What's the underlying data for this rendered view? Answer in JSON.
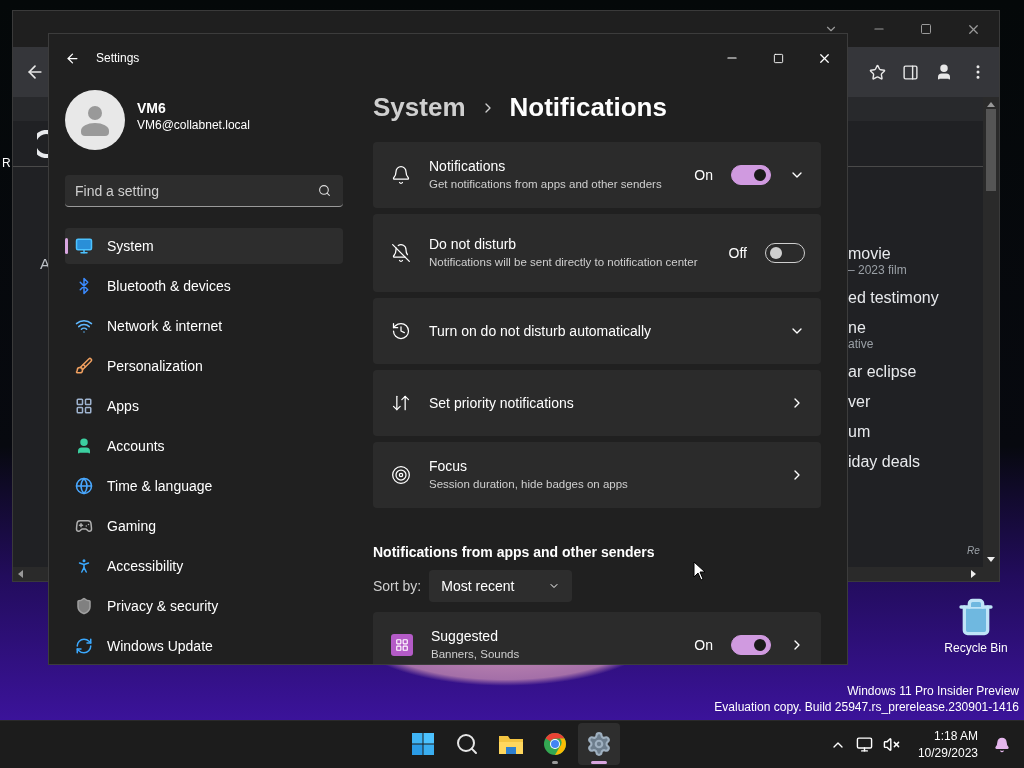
{
  "desktop": {
    "icons": [
      {
        "label": "Recycle Bin"
      }
    ],
    "edge_label": "R",
    "watermark": [
      "Windows 11 Pro Insider Preview",
      "Evaluation copy. Build 25947.rs_prerelease.230901-1416"
    ]
  },
  "browser": {
    "left_fragment": "A",
    "suggestions": [
      {
        "title": "movie",
        "subtitle": "– 2023 film"
      },
      {
        "title": "ed testimony"
      },
      {
        "title": "ne",
        "subtitle": "ative"
      },
      {
        "title": "ar eclipse"
      },
      {
        "title": "ver"
      },
      {
        "title": "um"
      },
      {
        "title": "iday deals"
      }
    ],
    "footer_text": "Re"
  },
  "settings": {
    "title": "Settings",
    "user": {
      "name": "VM6",
      "email": "VM6@collabnet.local"
    },
    "search": {
      "placeholder": "Find a setting"
    },
    "nav": [
      {
        "label": "System",
        "selected": true
      },
      {
        "label": "Bluetooth & devices",
        "selected": false
      },
      {
        "label": "Network & internet",
        "selected": false
      },
      {
        "label": "Personalization",
        "selected": false
      },
      {
        "label": "Apps",
        "selected": false
      },
      {
        "label": "Accounts",
        "selected": false
      },
      {
        "label": "Time & language",
        "selected": false
      },
      {
        "label": "Gaming",
        "selected": false
      },
      {
        "label": "Accessibility",
        "selected": false
      },
      {
        "label": "Privacy & security",
        "selected": false
      },
      {
        "label": "Windows Update",
        "selected": false
      }
    ],
    "breadcrumb": [
      "System",
      "Notifications"
    ],
    "cards": [
      {
        "kind": "toggle_expand",
        "title": "Notifications",
        "subtitle": "Get notifications from apps and other senders",
        "state_label": "On",
        "on": true
      },
      {
        "kind": "toggle",
        "title": "Do not disturb",
        "subtitle": "Notifications will be sent directly to notification center",
        "state_label": "Off",
        "on": false
      },
      {
        "kind": "expand",
        "title": "Turn on do not disturb automatically"
      },
      {
        "kind": "link",
        "title": "Set priority notifications"
      },
      {
        "kind": "link",
        "title": "Focus",
        "subtitle": "Session duration, hide badges on apps"
      }
    ],
    "section_heading": "Notifications from apps and other senders",
    "sort": {
      "label": "Sort by:",
      "value": "Most recent"
    },
    "app_rows": [
      {
        "title": "Suggested",
        "subtitle": "Banners, Sounds",
        "state_label": "On",
        "on": true
      }
    ]
  },
  "taskbar": {
    "apps": [
      {
        "selected": false,
        "running": false
      },
      {
        "selected": false,
        "running": false
      },
      {
        "selected": false,
        "running": false
      },
      {
        "selected": false,
        "running": true
      },
      {
        "selected": true,
        "running": true
      }
    ],
    "time": "1:18 AM",
    "date": "10/29/2023"
  }
}
